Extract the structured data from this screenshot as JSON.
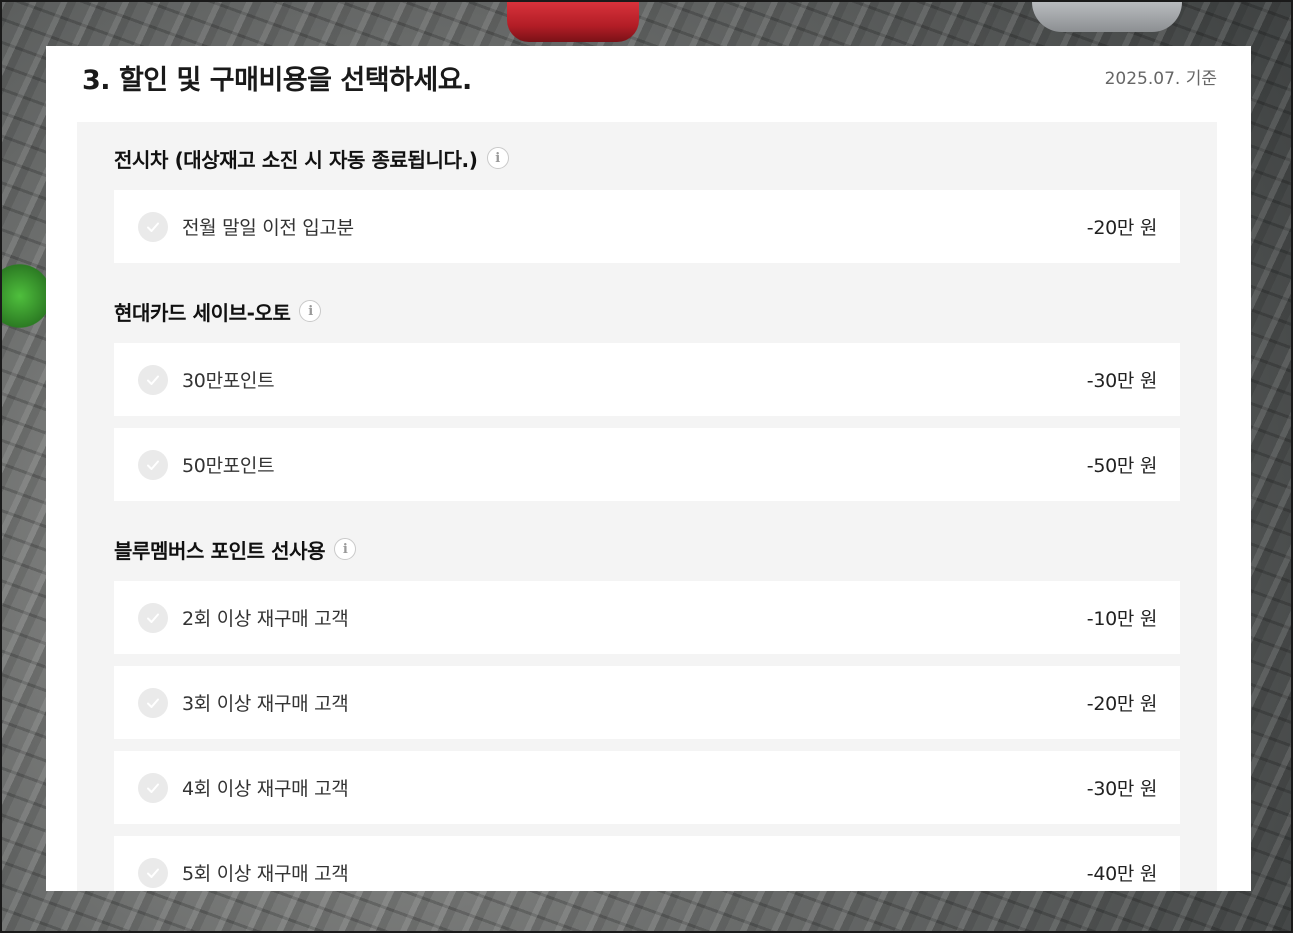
{
  "header": {
    "title": "3. 할인 및 구매비용을 선택하세요.",
    "date": "2025.07. 기준"
  },
  "groups": [
    {
      "title": "전시차 (대상재고 소진 시 자동 종료됩니다.)",
      "options": [
        {
          "label": "전월 말일 이전 입고분",
          "price": "-20만 원"
        }
      ]
    },
    {
      "title": "현대카드 세이브-오토",
      "options": [
        {
          "label": "30만포인트",
          "price": "-30만 원"
        },
        {
          "label": "50만포인트",
          "price": "-50만 원"
        }
      ]
    },
    {
      "title": "블루멤버스 포인트 선사용",
      "options": [
        {
          "label": "2회 이상 재구매 고객",
          "price": "-10만 원"
        },
        {
          "label": "3회 이상 재구매 고객",
          "price": "-20만 원"
        },
        {
          "label": "4회 이상 재구매 고객",
          "price": "-30만 원"
        },
        {
          "label": "5회 이상 재구매 고객",
          "price": "-40만 원"
        }
      ]
    }
  ],
  "icons": {
    "info": "info-icon",
    "check": "check-icon"
  },
  "info_glyph": "i"
}
